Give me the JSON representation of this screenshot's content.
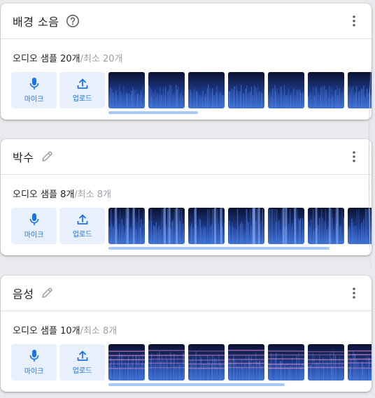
{
  "classes": [
    {
      "title": "배경 소음",
      "header_icon": "help-circle-icon",
      "samples_text": "오디오 샘플 20개",
      "minimum_text": "/최소 20개",
      "mic_label": "마이크",
      "upload_label": "업로드",
      "thumb_style": "noise",
      "scroll_fraction": 0.34
    },
    {
      "title": "박수",
      "header_icon": "pencil-icon",
      "samples_text": "오디오 샘플 8개",
      "minimum_text": "/최소 8개",
      "mic_label": "마이크",
      "upload_label": "업로드",
      "thumb_style": "clap",
      "scroll_fraction": 0.84
    },
    {
      "title": "음성",
      "header_icon": "pencil-icon",
      "samples_text": "오디오 샘플 10개",
      "minimum_text": "/최소 8개",
      "mic_label": "마이크",
      "upload_label": "업로드",
      "thumb_style": "voice",
      "scroll_fraction": 0.67
    }
  ],
  "colors": {
    "accent": "#1a73e8",
    "button_bg": "#e8f0fe",
    "scrollbar": "#a8c7fa",
    "spectrogram_dark": "#0b1230",
    "spectrogram_blue": "#3b6fd1",
    "spectrogram_pink": "#e58ac8"
  }
}
